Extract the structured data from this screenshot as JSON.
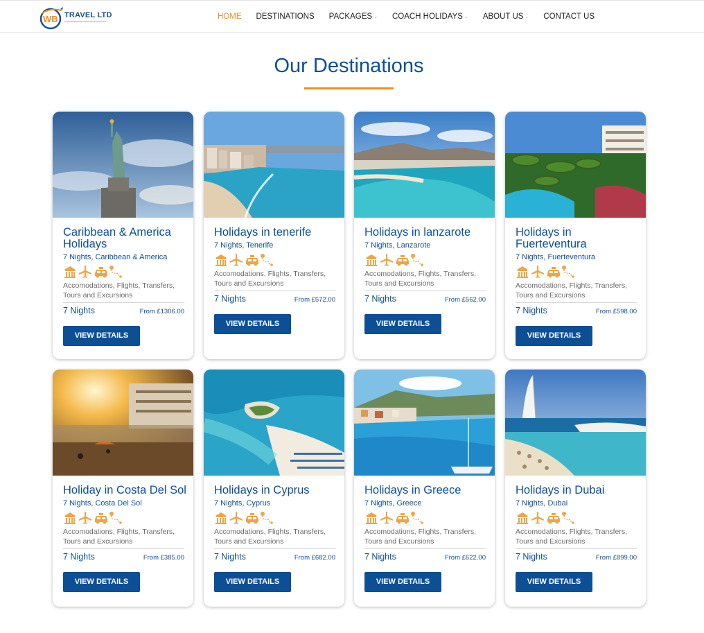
{
  "brand": {
    "name": "TRAVEL LTD",
    "logo_initials": "WB"
  },
  "nav": [
    {
      "label": "HOME",
      "active": true,
      "dropdown": false
    },
    {
      "label": "DESTINATIONS",
      "active": false,
      "dropdown": false
    },
    {
      "label": "PACKAGES",
      "active": false,
      "dropdown": true
    },
    {
      "label": "COACH HOLIDAYS",
      "active": false,
      "dropdown": true
    },
    {
      "label": "ABOUT US",
      "active": false,
      "dropdown": true
    },
    {
      "label": "CONTACT US",
      "active": false,
      "dropdown": false
    }
  ],
  "page": {
    "title": "Our Destinations"
  },
  "colors": {
    "primary": "#0d4f94",
    "accent": "#f0901a",
    "text_muted": "#6b6b6b"
  },
  "amenity_icons": [
    "hotel-icon",
    "plane-icon",
    "taxi-icon",
    "route-icon"
  ],
  "view_details_label": "VIEW DETAILS",
  "cards": [
    {
      "title": "Caribbean & America",
      "title2": "Holidays",
      "subtitle": "7 Nights, Caribbean & America",
      "desc1": "Accomodations, Flights, Transfers,",
      "desc2": "Tours and Excursions",
      "nights": "7 Nights",
      "price": "From £1306.00",
      "image": "statue-of-liberty"
    },
    {
      "title": "Holidays in tenerife",
      "title2": "",
      "subtitle": "7 Nights, Tenerife",
      "desc1": "Accomodations, Flights, Transfers,",
      "desc2": "Tours and Excursions",
      "nights": "7 Nights",
      "price": "From £572.00",
      "image": "beach-bay"
    },
    {
      "title": "Holidays in lanzarote",
      "title2": "",
      "subtitle": "7 Nights, Lanzarote",
      "desc1": "Accomodations, Flights, Transfers,",
      "desc2": "Tours and Excursions",
      "nights": "7 Nights",
      "price": "From £562.00",
      "image": "coastline-mountains"
    },
    {
      "title": "Holidays in",
      "title2": "Fuerteventura",
      "subtitle": "7 Nights, Fuerteventura",
      "desc1": "Accomodations, Flights, Transfers,",
      "desc2": "Tours and Excursions",
      "nights": "7 Nights",
      "price": "From £598.00",
      "image": "resort-palms"
    },
    {
      "title": "Holiday in Costa Del Sol",
      "title2": "",
      "subtitle": "7 Nights, Costa Del Sol",
      "desc1": "Accomodations, Flights, Transfers,",
      "desc2": "Tours and Excursions",
      "nights": "7 Nights",
      "price": "From £385.00",
      "image": "sunset-beach"
    },
    {
      "title": "Holidays in Cyprus",
      "title2": "",
      "subtitle": "7 Nights, Cyprus",
      "desc1": "Accomodations, Flights, Transfers,",
      "desc2": "Tours and Excursions",
      "nights": "7 Nights",
      "price": "From £682.00",
      "image": "aerial-lagoon"
    },
    {
      "title": "Holidays in Greece",
      "title2": "",
      "subtitle": "7 Nights, Greece",
      "desc1": "Accomodations, Flights, Transfers,",
      "desc2": "Tours and Excursions",
      "nights": "7 Nights",
      "price": "From £622.00",
      "image": "greek-bay-sailboat"
    },
    {
      "title": "Holidays in Dubai",
      "title2": "",
      "subtitle": "7 Nights, Dubai",
      "desc1": "Accomodations, Flights, Transfers,",
      "desc2": "Tours and Excursions",
      "nights": "7 Nights",
      "price": "From £899.00",
      "image": "burj-al-arab"
    }
  ]
}
